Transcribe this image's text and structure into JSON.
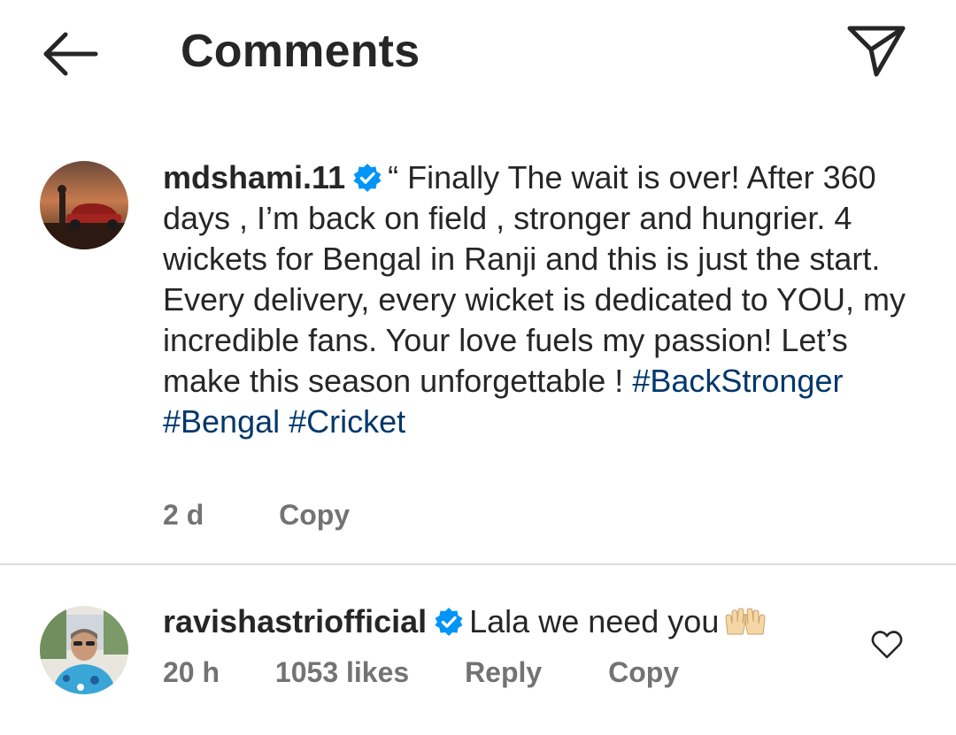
{
  "header": {
    "title": "Comments",
    "back_icon": "arrow-left-icon",
    "send_icon": "paper-plane-icon"
  },
  "caption": {
    "username": "mdshami.11",
    "text": "“ Finally The wait is over! After 360 days , I’m back on field , stronger and hungrier. 4 wickets for Bengal in Ranji and this is just the start. Every delivery, every wicket is dedicated to YOU, my incredible fans. Your love fuels my passion! Let’s make this season unforgettable ! ",
    "hashtags": [
      "#BackStronger",
      "#Bengal",
      "#Cricket"
    ],
    "time": "2 d",
    "copy_label": "Copy"
  },
  "comment": {
    "username": "ravishastriofficial",
    "text": "Lala we need you",
    "emoji": "raising-hands-emoji",
    "time": "20 h",
    "likes": "1053 likes",
    "reply_label": "Reply",
    "copy_label": "Copy",
    "like_icon": "heart-outline-icon"
  },
  "colors": {
    "text": "#262626",
    "secondary": "#737373",
    "hashtag": "#00376b",
    "verified": "#0095f6",
    "divider": "#dbdbdb"
  }
}
